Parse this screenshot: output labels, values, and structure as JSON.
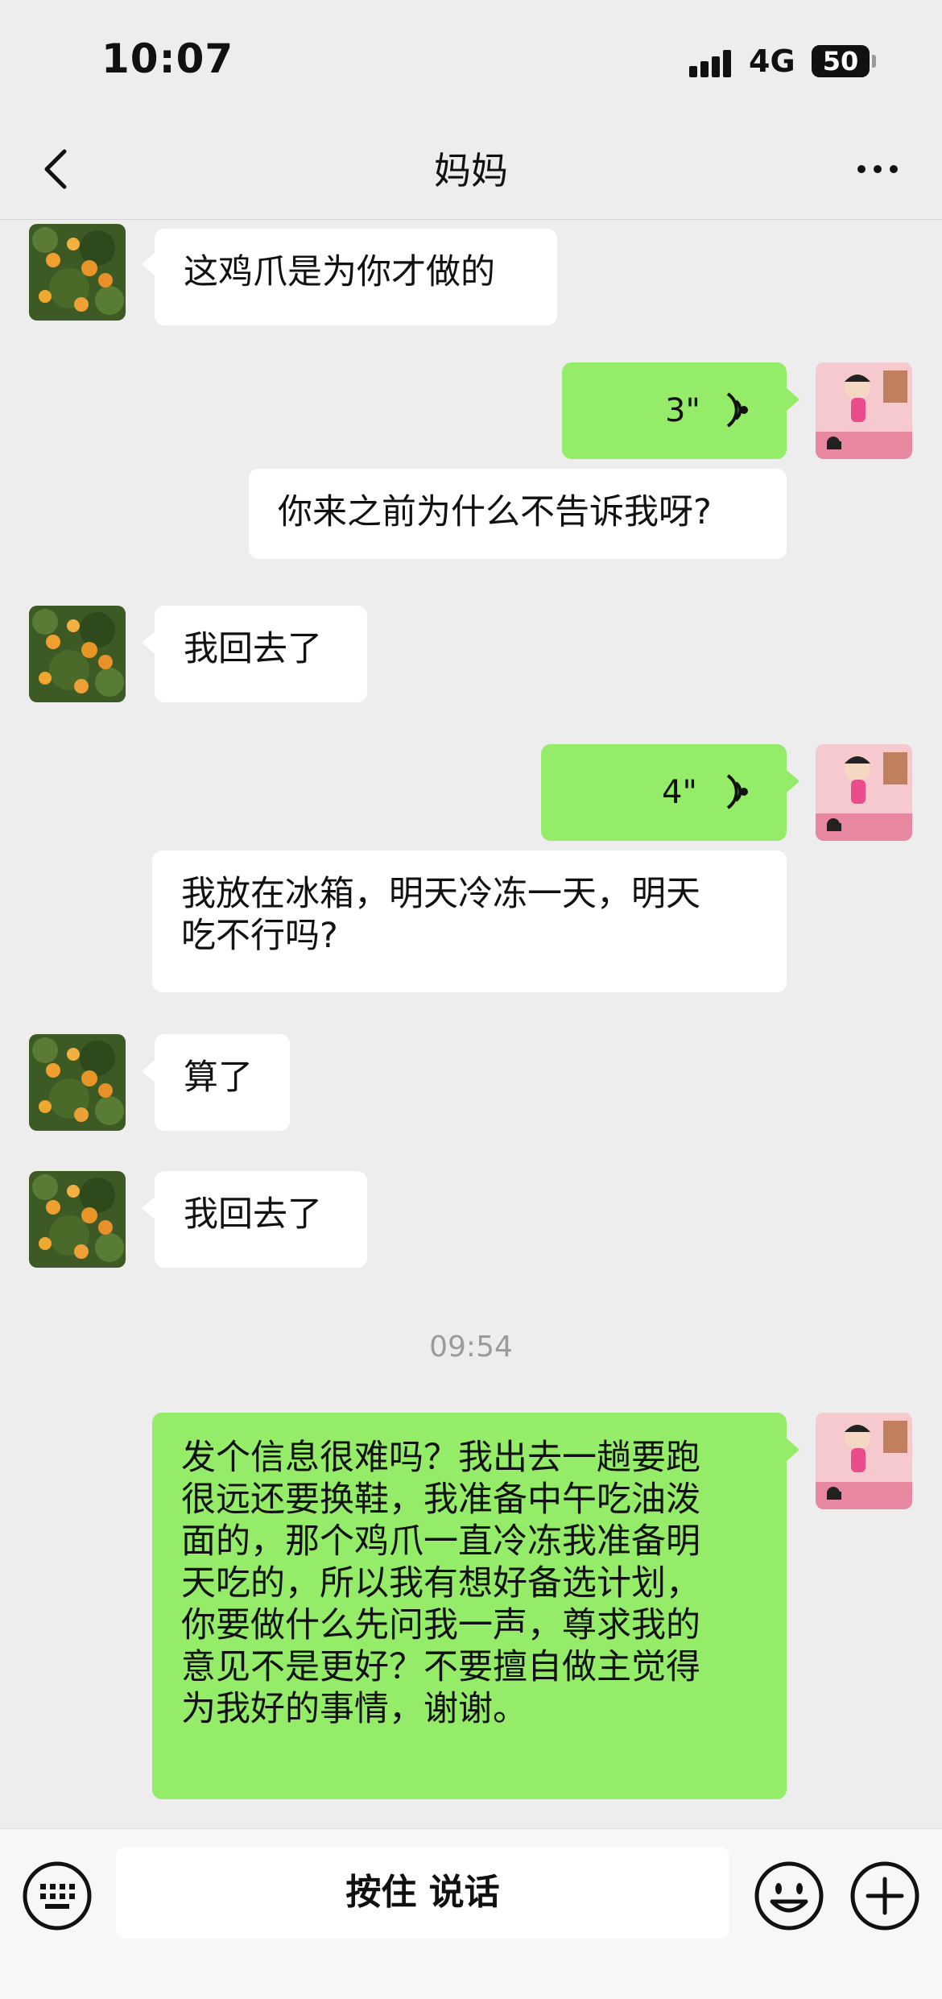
{
  "status_bar": {
    "time": "10:07",
    "network": "4G",
    "battery": "50"
  },
  "header": {
    "title": "妈妈"
  },
  "messages": [
    {
      "side": "left",
      "type": "text",
      "text": "这鸡爪是为你才做的"
    },
    {
      "side": "right",
      "type": "voice",
      "duration": "3\""
    },
    {
      "side": "right",
      "type": "transcript",
      "text": "你来之前为什么不告诉我呀?"
    },
    {
      "side": "left",
      "type": "text",
      "text": "我回去了"
    },
    {
      "side": "right",
      "type": "voice",
      "duration": "4\""
    },
    {
      "side": "right",
      "type": "transcript",
      "lines": [
        "我放在冰箱，明天冷冻一天，明天",
        "吃不行吗?"
      ]
    },
    {
      "side": "left",
      "type": "text",
      "text": "算了"
    },
    {
      "side": "left",
      "type": "text",
      "text": "我回去了"
    },
    {
      "type": "timestamp",
      "text": "09:54"
    },
    {
      "side": "right",
      "type": "text",
      "lines": [
        "发个信息很难吗？我出去一趟要跑",
        "很远还要换鞋，我准备中午吃油泼",
        "面的，那个鸡爪一直冷冻我准备明",
        "天吃的，所以我有想好备选计划，",
        "你要做什么先问我一声，尊求我的",
        "意见不是更好？不要擅自做主觉得",
        "为我好的事情，谢谢。"
      ]
    }
  ],
  "input_bar": {
    "hold_to_talk": "按住 说话"
  },
  "colors": {
    "background": "#ededed",
    "sent_bubble": "#95ec69",
    "received_bubble": "#ffffff"
  },
  "icons": [
    "back-icon",
    "more-icon",
    "voice-wave-icon",
    "keyboard-icon",
    "emoji-icon",
    "plus-icon"
  ]
}
